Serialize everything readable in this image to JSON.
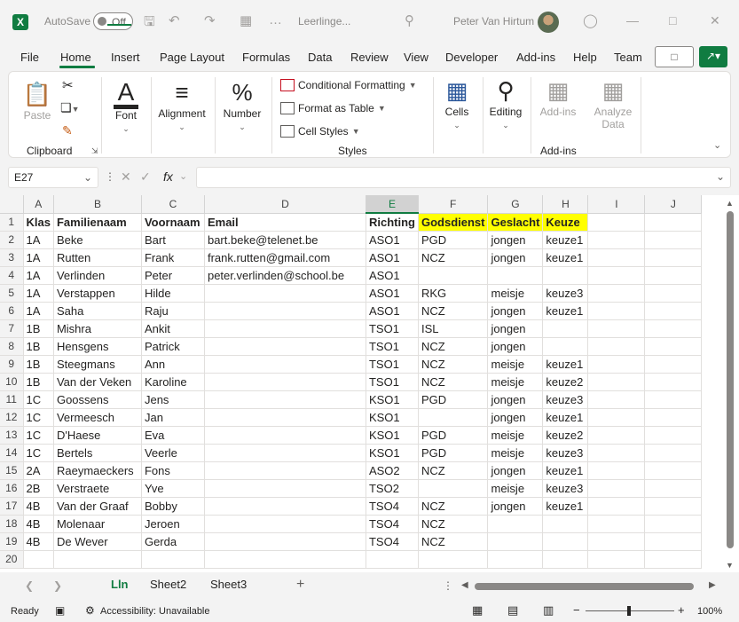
{
  "title_bar": {
    "autosave_label": "AutoSave",
    "autosave_state": "Off",
    "document_name": "Leerlinge...",
    "user_name": "Peter Van Hirtum"
  },
  "menu": [
    "File",
    "Home",
    "Insert",
    "Page Layout",
    "Formulas",
    "Data",
    "Review",
    "View",
    "Developer",
    "Add-ins",
    "Help",
    "Team"
  ],
  "ribbon": {
    "paste": "Paste",
    "clipboard": "Clipboard",
    "font": "Font",
    "alignment": "Alignment",
    "number": "Number",
    "conditional_formatting": "Conditional Formatting",
    "format_as_table": "Format as Table",
    "cell_styles": "Cell Styles",
    "styles": "Styles",
    "cells": "Cells",
    "editing": "Editing",
    "addins_btn": "Add-ins",
    "analyze_data_1": "Analyze",
    "analyze_data_2": "Data",
    "addins_group": "Add-ins"
  },
  "formula_bar": {
    "name_box": "E27",
    "fx": "fx",
    "value": ""
  },
  "columns": [
    "A",
    "B",
    "C",
    "D",
    "E",
    "F",
    "G",
    "H",
    "I",
    "J"
  ],
  "selected_column": "E",
  "rows": [
    [
      "Klas",
      "Familienaam",
      "Voornaam",
      "Email",
      "Richting",
      "Godsdienst",
      "Geslacht",
      "Keuze",
      "",
      ""
    ],
    [
      "1A",
      "Beke",
      "Bart",
      "bart.beke@telenet.be",
      "ASO1",
      "PGD",
      "jongen",
      "keuze1",
      "",
      ""
    ],
    [
      "1A",
      "Rutten",
      "Frank",
      "frank.rutten@gmail.com",
      "ASO1",
      "NCZ",
      "jongen",
      "keuze1",
      "",
      ""
    ],
    [
      "1A",
      "Verlinden",
      "Peter",
      "peter.verlinden@school.be",
      "ASO1",
      "",
      "",
      "",
      "",
      ""
    ],
    [
      "1A",
      "Verstappen",
      "Hilde",
      "",
      "ASO1",
      "RKG",
      "meisje",
      "keuze3",
      "",
      ""
    ],
    [
      "1A",
      "Saha",
      "Raju",
      "",
      "ASO1",
      "NCZ",
      "jongen",
      "keuze1",
      "",
      ""
    ],
    [
      "1B",
      "Mishra",
      "Ankit",
      "",
      "TSO1",
      "ISL",
      "jongen",
      "",
      "",
      ""
    ],
    [
      "1B",
      "Hensgens",
      "Patrick",
      "",
      "TSO1",
      "NCZ",
      "jongen",
      "",
      "",
      ""
    ],
    [
      "1B",
      "Steegmans",
      "Ann",
      "",
      "TSO1",
      "NCZ",
      "meisje",
      "keuze1",
      "",
      ""
    ],
    [
      "1B",
      "Van der Veken",
      "Karoline",
      "",
      "TSO1",
      "NCZ",
      "meisje",
      "keuze2",
      "",
      ""
    ],
    [
      "1C",
      "Goossens",
      "Jens",
      "",
      "KSO1",
      "PGD",
      "jongen",
      "keuze3",
      "",
      ""
    ],
    [
      "1C",
      "Vermeesch",
      "Jan",
      "",
      "KSO1",
      "",
      "jongen",
      "keuze1",
      "",
      ""
    ],
    [
      "1C",
      "D'Haese",
      "Eva",
      "",
      "KSO1",
      "PGD",
      "meisje",
      "keuze2",
      "",
      ""
    ],
    [
      "1C",
      "Bertels",
      "Veerle",
      "",
      "KSO1",
      "PGD",
      "meisje",
      "keuze3",
      "",
      ""
    ],
    [
      "2A",
      "Raeymaeckers",
      "Fons",
      "",
      "ASO2",
      "NCZ",
      "jongen",
      "keuze1",
      "",
      ""
    ],
    [
      "2B",
      "Verstraete",
      "Yve",
      "",
      "TSO2",
      "",
      "meisje",
      "keuze3",
      "",
      ""
    ],
    [
      "4B",
      "Van der Graaf",
      "Bobby",
      "",
      "TSO4",
      "NCZ",
      "jongen",
      "keuze1",
      "",
      ""
    ],
    [
      "4B",
      "Molenaar",
      "Jeroen",
      "",
      "TSO4",
      "NCZ",
      "",
      "",
      "",
      ""
    ],
    [
      "4B",
      "De Wever",
      "Gerda",
      "",
      "TSO4",
      "NCZ",
      "",
      "",
      "",
      ""
    ],
    [
      "",
      "",
      "",
      "",
      "",
      "",
      "",
      "",
      "",
      ""
    ]
  ],
  "highlight_color": "#ffff00",
  "sheets": [
    "Lln",
    "Sheet2",
    "Sheet3"
  ],
  "active_sheet": "Lln",
  "status_bar": {
    "ready": "Ready",
    "accessibility": "Accessibility: Unavailable",
    "zoom": "100%"
  },
  "accent_color": "#107c41"
}
